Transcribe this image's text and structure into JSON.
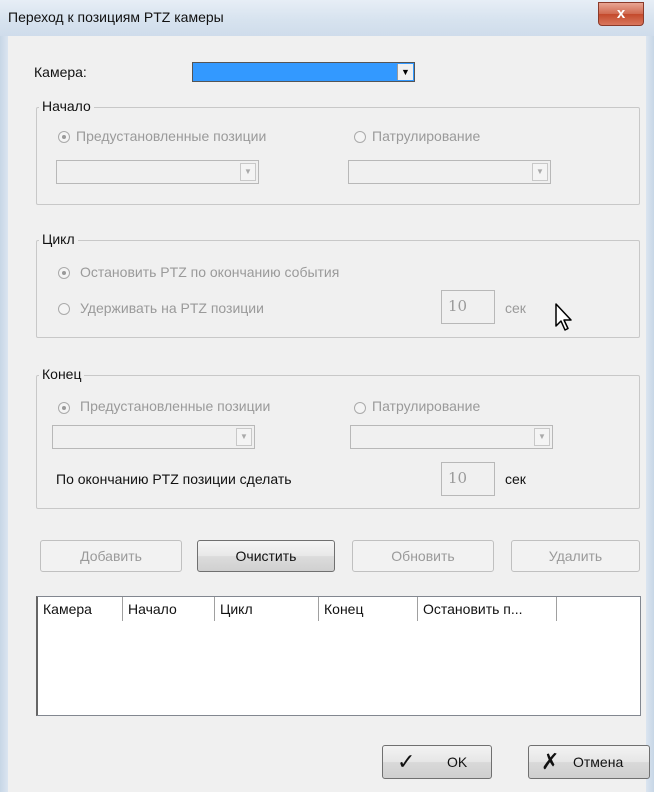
{
  "window": {
    "title": "Переход к позициям PTZ камеры",
    "close_glyph": "x"
  },
  "camera": {
    "label": "Камера:",
    "value": "",
    "arrow_glyph": "▼"
  },
  "start": {
    "title": "Начало",
    "radio_presets": "Предустановленные позиции",
    "radio_patrol": "Патрулирование",
    "presets_selected": true
  },
  "cycle": {
    "title": "Цикл",
    "radio_stop": "Остановить PTZ по окончанию события",
    "radio_hold": "Удерживать на PTZ позиции",
    "hold_value": "10",
    "unit": "сек",
    "stop_selected": true
  },
  "end": {
    "title": "Конец",
    "radio_presets": "Предустановленные позиции",
    "radio_patrol": "Патрулирование",
    "after_label": "По окончанию PTZ позиции сделать",
    "after_value": "10",
    "unit": "сек"
  },
  "buttons": {
    "add": "Добавить",
    "clear": "Очистить",
    "update": "Обновить",
    "delete": "Удалить"
  },
  "table": {
    "columns": [
      "Камера",
      "Начало",
      "Цикл",
      "Конец",
      "Остановить п..."
    ]
  },
  "footer": {
    "ok": "OK",
    "ok_glyph": "✓",
    "cancel": "Отмена",
    "cancel_glyph": "✗"
  },
  "icons": {
    "close": "close-icon",
    "dropdown": "chevron-down-icon",
    "ok": "checkmark-icon",
    "cancel": "cross-icon",
    "cursor": "mouse-pointer-icon"
  },
  "colors": {
    "selection": "#3399ff",
    "close_button": "#c44a2c",
    "disabled_text": "#9a9a9a"
  }
}
